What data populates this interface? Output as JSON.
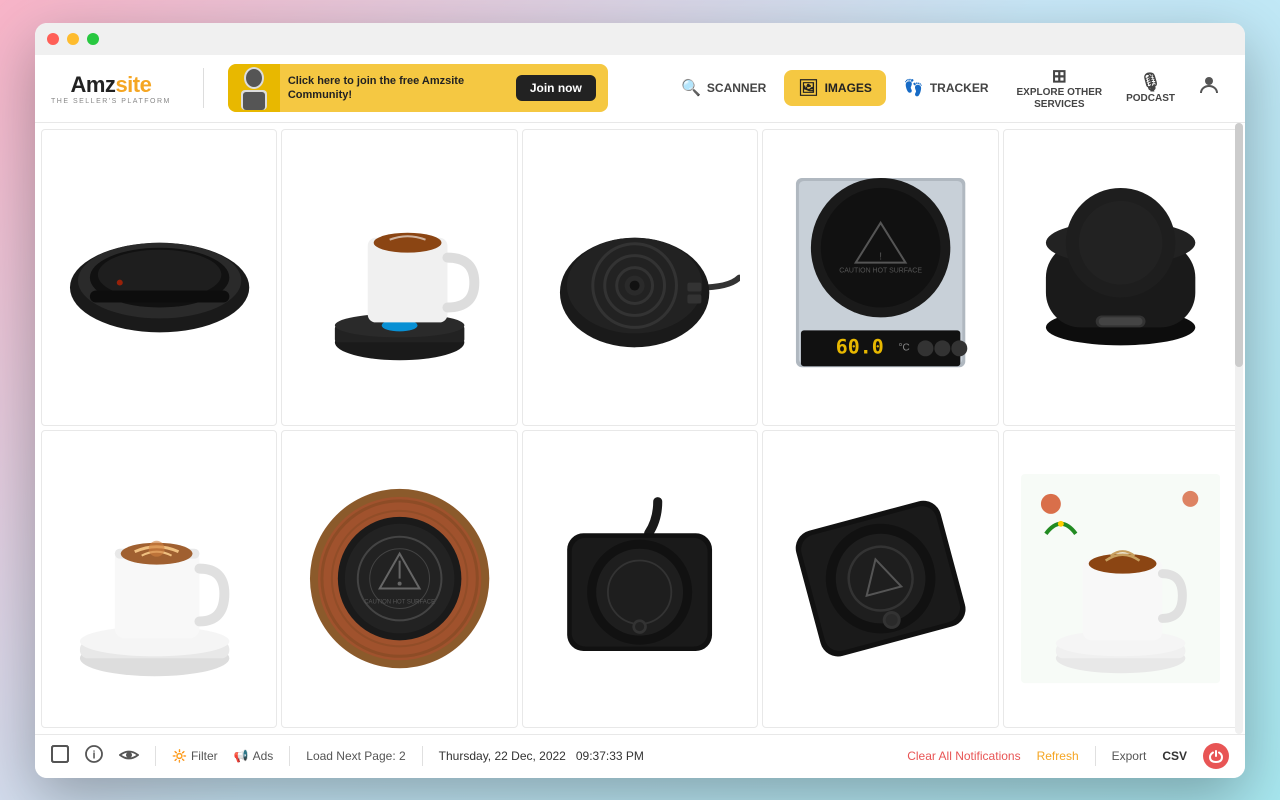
{
  "window": {
    "title": "Amzsite"
  },
  "titlebar": {
    "close_label": "✕",
    "min_label": "−",
    "max_label": "+"
  },
  "logo": {
    "name_prefix": "Amz",
    "name_suffix": "site",
    "tagline": "THE SELLER'S PLATFORM"
  },
  "banner": {
    "text": "Click here to join the free Amzsite Community!",
    "cta_label": "Join now"
  },
  "nav": {
    "scanner_label": "SCANNER",
    "scanner_icon": "🔍",
    "images_label": "IMAGES",
    "images_icon": "🖼",
    "tracker_label": "TRACKER",
    "tracker_icon": "👣",
    "explore_label": "EXPLORE OTHER\nSERVICES",
    "podcast_label": "PODCAST",
    "podcast_icon": "🎙"
  },
  "footer": {
    "load_next_label": "Load Next Page: 2",
    "datetime": "Thursday, 22 Dec, 2022",
    "time": "09:37:33 PM",
    "clear_label": "Clear All Notifications",
    "refresh_label": "Refresh",
    "export_label": "Export",
    "csv_label": "CSV",
    "filter_label": "Filter",
    "ads_label": "Ads"
  },
  "products": [
    {
      "id": 1,
      "alt": "Black oval mug warmer device",
      "row": 1,
      "col": 1
    },
    {
      "id": 2,
      "alt": "White mug on black warmer with blue LED",
      "row": 1,
      "col": 2
    },
    {
      "id": 3,
      "alt": "Black round warmer with cable",
      "row": 1,
      "col": 3
    },
    {
      "id": 4,
      "alt": "Silver induction warmer with temperature display",
      "row": 1,
      "col": 4
    },
    {
      "id": 5,
      "alt": "Sleek black round warmer",
      "row": 1,
      "col": 5
    },
    {
      "id": 6,
      "alt": "White mug on white warmer with latte art",
      "row": 2,
      "col": 1
    },
    {
      "id": 7,
      "alt": "Round wooden-rimmed warmer",
      "row": 2,
      "col": 2
    },
    {
      "id": 8,
      "alt": "Black square warmer with cord",
      "row": 2,
      "col": 3
    },
    {
      "id": 9,
      "alt": "Black square warmer device",
      "row": 2,
      "col": 4
    },
    {
      "id": 10,
      "alt": "White mug with latte art on Christmas warmer",
      "row": 2,
      "col": 5
    }
  ]
}
